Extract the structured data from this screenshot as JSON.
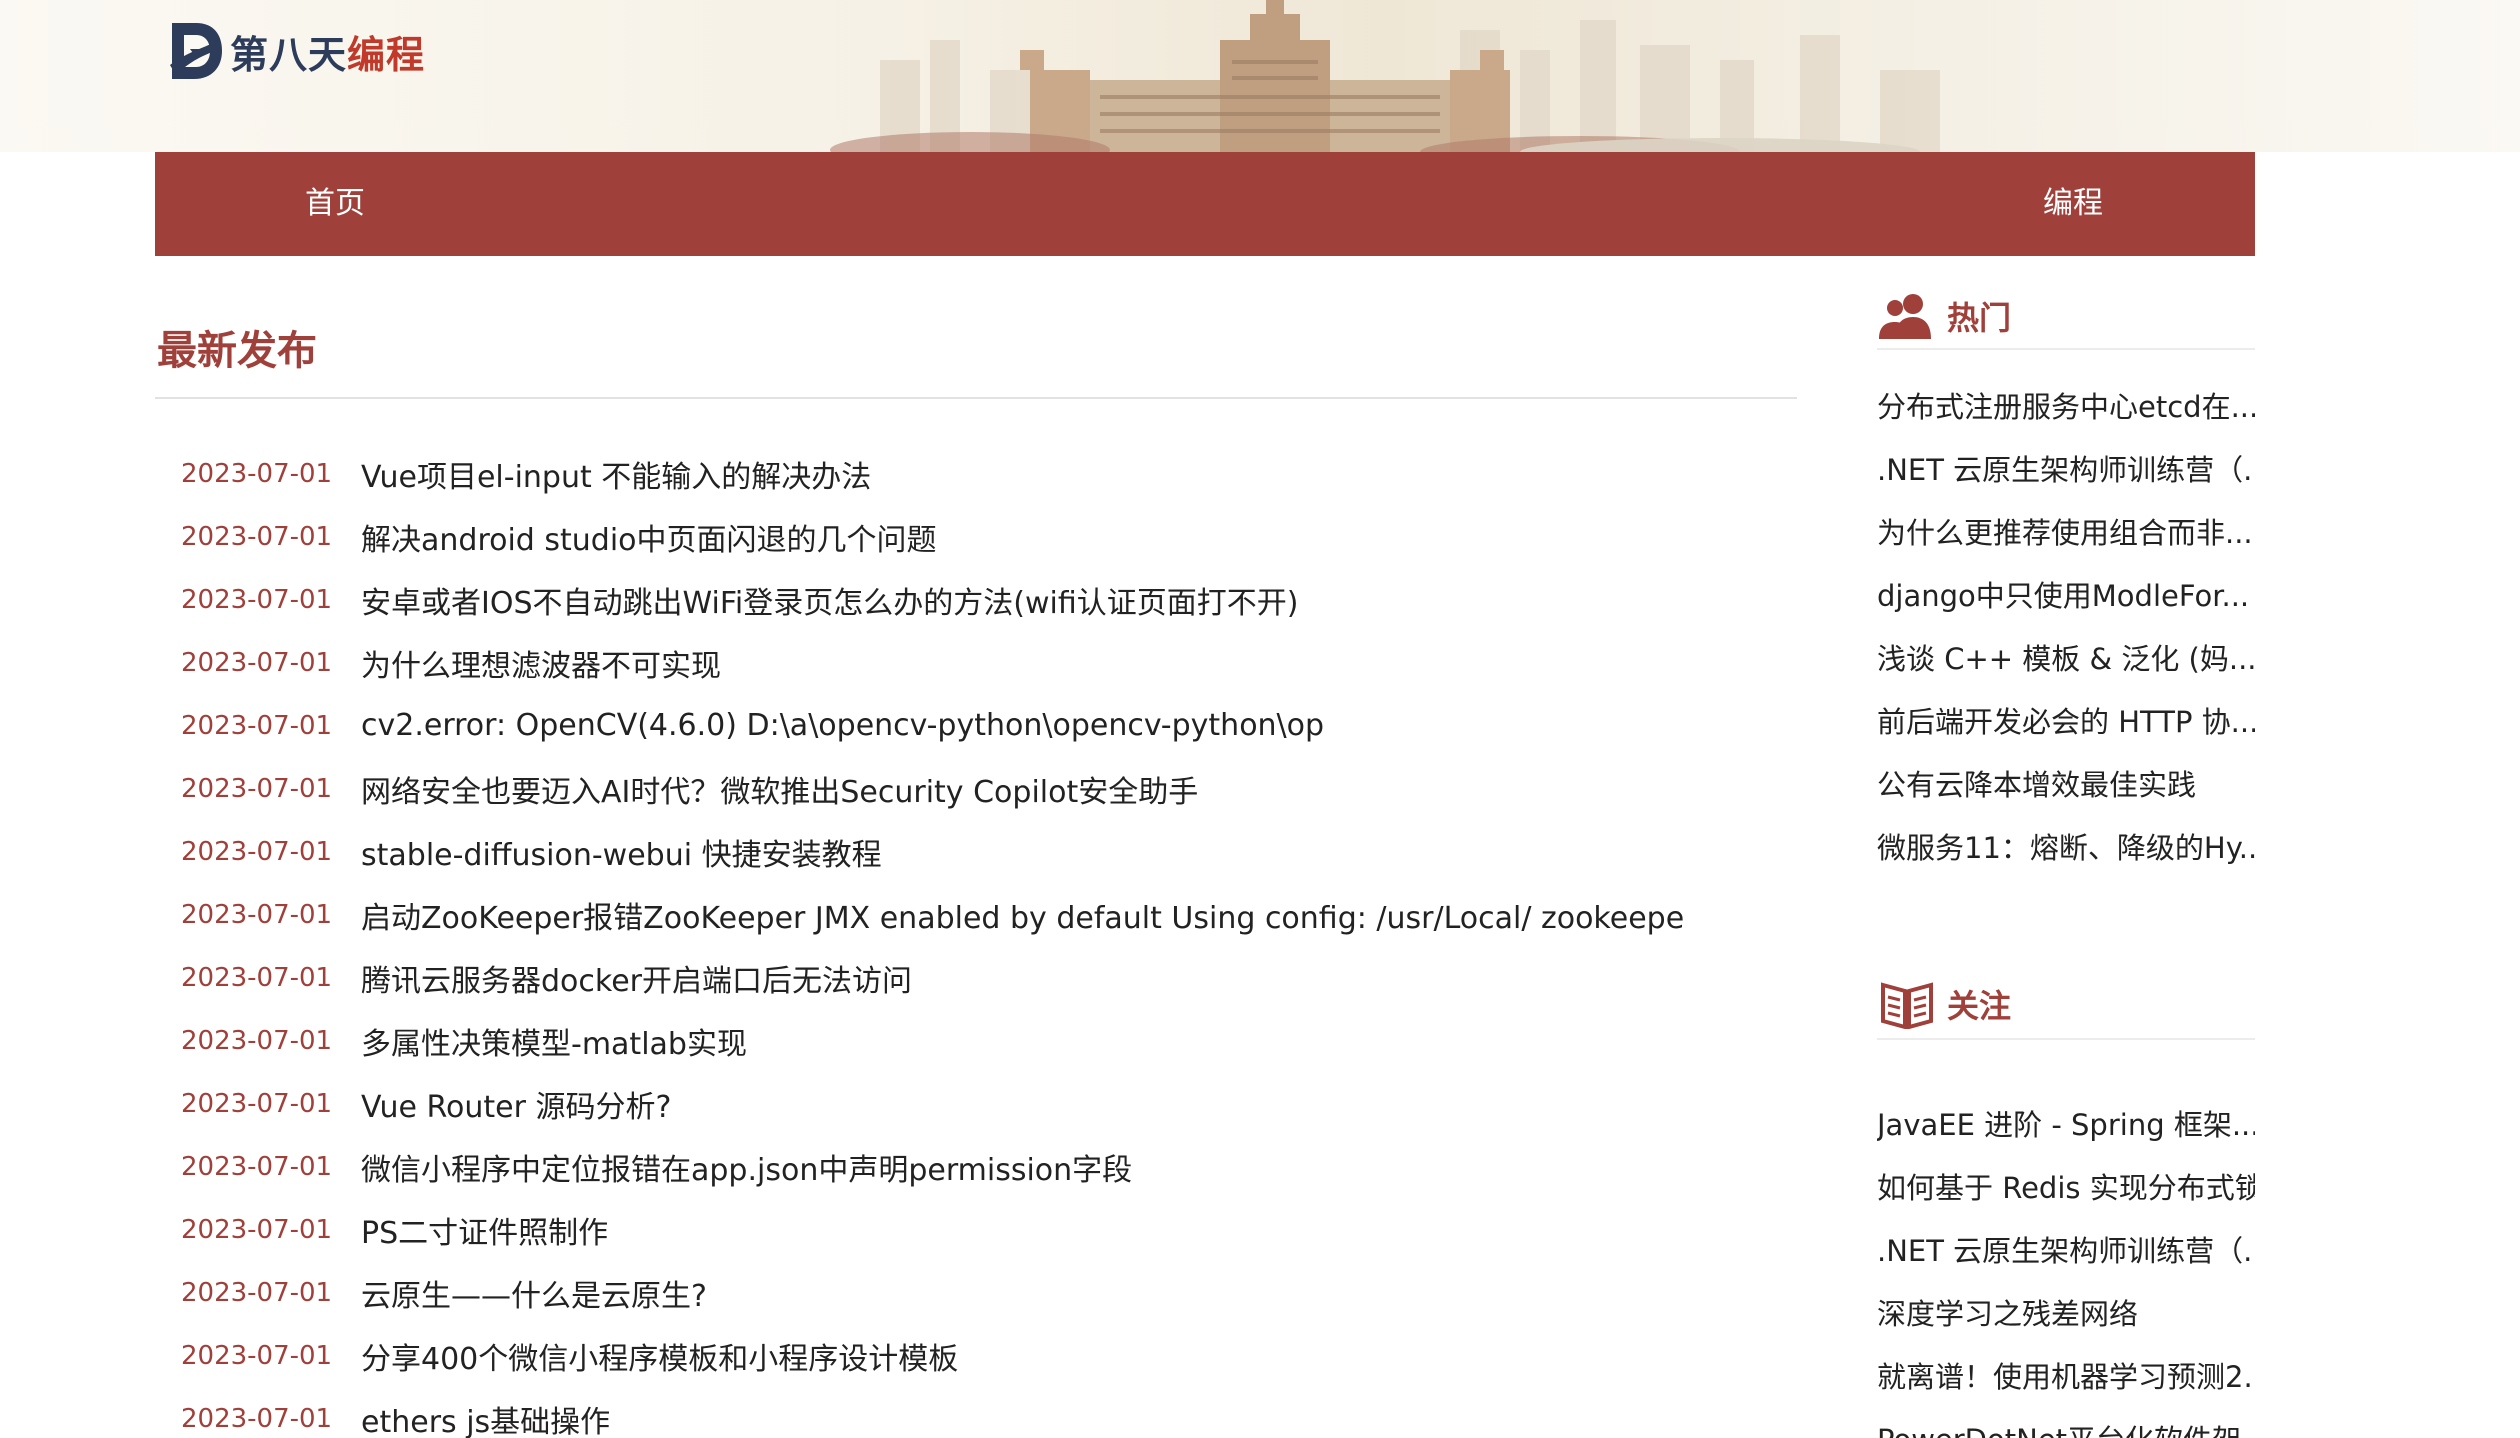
{
  "brand": {
    "name_part1": "第八天",
    "name_part2": "编程"
  },
  "nav": {
    "items": [
      {
        "label": "首页"
      },
      {
        "label": "编程"
      }
    ]
  },
  "main": {
    "section_title": "最新发布",
    "posts": [
      {
        "date": "2023-07-01",
        "title": "Vue项目el-input 不能输入的解决办法"
      },
      {
        "date": "2023-07-01",
        "title": "解决android studio中页面闪退的几个问题"
      },
      {
        "date": "2023-07-01",
        "title": "安卓或者IOS不自动跳出WiFi登录页怎么办的方法(wifi认证页面打不开)"
      },
      {
        "date": "2023-07-01",
        "title": "为什么理想滤波器不可实现"
      },
      {
        "date": "2023-07-01",
        "title": "cv2.error: OpenCV(4.6.0) D:\\a\\opencv-python\\opencv-python\\op"
      },
      {
        "date": "2023-07-01",
        "title": "网络安全也要迈入AI时代？微软推出Security Copilot安全助手"
      },
      {
        "date": "2023-07-01",
        "title": "stable-diffusion-webui 快捷安装教程"
      },
      {
        "date": "2023-07-01",
        "title": "启动ZooKeeper报错ZooKeeper JMX enabled by default Using config: /usr/Local/ zookeepe"
      },
      {
        "date": "2023-07-01",
        "title": "腾讯云服务器docker开启端口后无法访问"
      },
      {
        "date": "2023-07-01",
        "title": "多属性决策模型-matlab实现"
      },
      {
        "date": "2023-07-01",
        "title": "Vue Router 源码分析?"
      },
      {
        "date": "2023-07-01",
        "title": "微信小程序中定位报错在app.json中声明permission字段"
      },
      {
        "date": "2023-07-01",
        "title": "PS二寸证件照制作"
      },
      {
        "date": "2023-07-01",
        "title": "云原生——什么是云原生?"
      },
      {
        "date": "2023-07-01",
        "title": "分享400个微信小程序模板和小程序设计模板"
      },
      {
        "date": "2023-07-01",
        "title": "ethers js基础操作"
      }
    ]
  },
  "sidebar": {
    "hot": {
      "title": "热门",
      "items": [
        "分布式注册服务中心etcd在...",
        ".NET 云原生架构师训练营（...",
        "为什么更推荐使用组合而非...",
        "django中只使用ModleFor...",
        "浅谈 C++ 模板 & 泛化 (妈...",
        "前后端开发必会的 HTTP 协...",
        "公有云降本增效最佳实践",
        "微服务11：熔断、降级的Hy..."
      ]
    },
    "follow": {
      "title": "关注",
      "items": [
        "JavaEE 进阶 - Spring 框架...",
        "如何基于 Redis 实现分布式锁",
        ".NET 云原生架构师训练营（...",
        "深度学习之残差网络",
        "就离谱！使用机器学习预测2...",
        "PowerDotNet平台化软件架..."
      ]
    }
  },
  "colors": {
    "accent": "#a0403b",
    "brand_dark": "#2c3c5a",
    "brand_red": "#c0392b"
  }
}
